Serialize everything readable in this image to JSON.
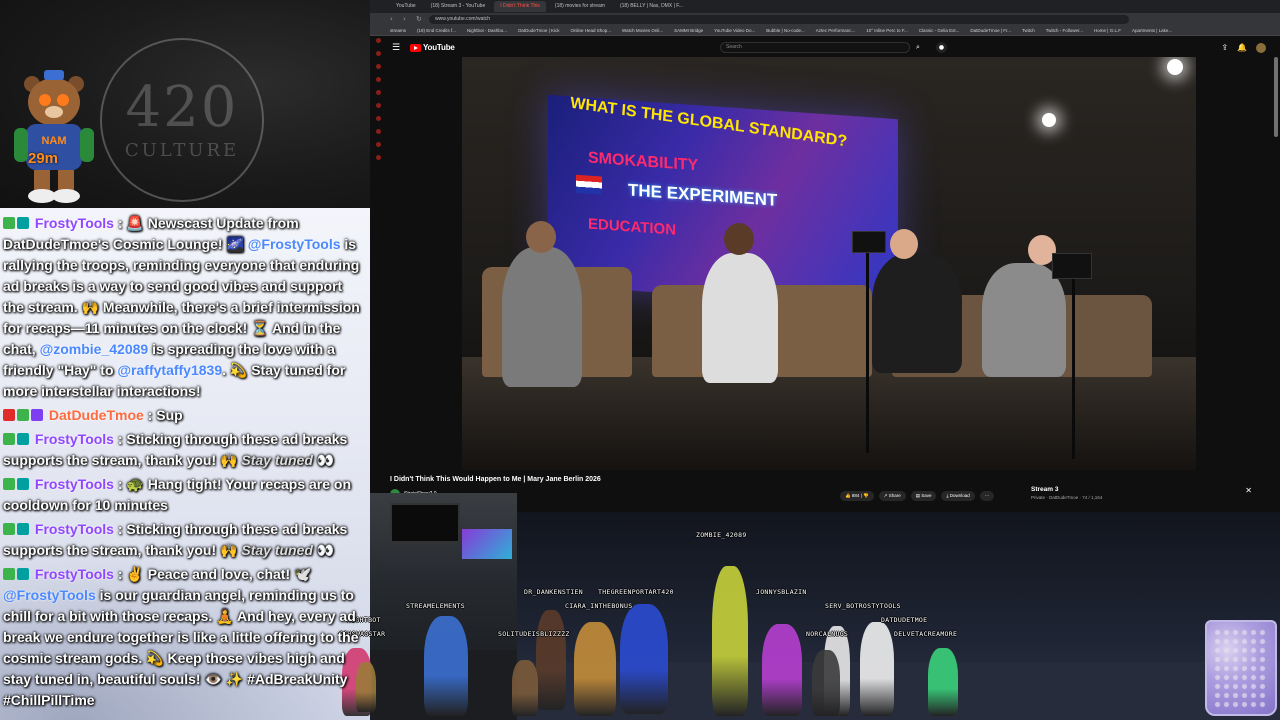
{
  "overlay": {
    "logo_number": "420",
    "logo_word": "CULTURE",
    "timer": "29m"
  },
  "chat": {
    "messages": [
      {
        "user": "FrostyTools",
        "parts": [
          " : 🚨 Newscast Update from DatDudeTmoe's Cosmic Lounge! 🌌 ",
          "@FrostyTools",
          " is rallying the troops, reminding everyone that enduring ad breaks is a way to send good vibes and support the stream. 🙌 Meanwhile, there's a brief intermission for recaps—11 minutes on the clock! ⏳ And in the chat, ",
          "@zombie_42089",
          " is spreading the love with a friendly \"Hay\" to ",
          "@raffytaffy1839",
          ". 💫 Stay tuned for more interstellar interactions!"
        ]
      },
      {
        "user": "DatDudeTmoe",
        "text": " : Sup"
      },
      {
        "user": "FrostyTools",
        "text": " : Sticking through these ad breaks supports the stream, thank you! 🙌 ",
        "tail": "Stay tuned",
        "end": " 👀"
      },
      {
        "user": "FrostyTools",
        "text": " : 🐢 Hang tight! Your recaps are on cooldown for 10 minutes"
      },
      {
        "user": "FrostyTools",
        "text": " : Sticking through these ad breaks supports the stream, thank you! 🙌 ",
        "tail": "Stay tuned",
        "end": " 👀"
      },
      {
        "user": "FrostyTools",
        "parts": [
          " : ✌️ Peace and love, chat! 🕊️ ",
          "@FrostyTools",
          " is our guardian angel, reminding us to chill for a bit with those recaps. 🧘 And hey, every ad break we endure together is like a little offering to the cosmic stream gods. 💫 Keep those vibes high and stay tuned in, beautiful souls! 👁️ ✨ #AdBreakUnity #ChillPillTime"
        ]
      }
    ]
  },
  "browser": {
    "tabs": [
      {
        "label": "YouTube",
        "active": false
      },
      {
        "label": "(18) Stream 3 - YouTube",
        "active": false
      },
      {
        "label": "I Didn't Think This",
        "active": true
      },
      {
        "label": "(18) movies for stream",
        "active": false
      },
      {
        "label": "(18) BELLY | Nas, DMX | F...",
        "active": false
      }
    ],
    "url": "www.youtube.com/watch",
    "bookmarks": [
      "streams",
      "(18) End Credits f...",
      "Nightbot - Dashbo...",
      "DatDudeTmoe | Kick",
      "Online Head Shop...",
      "Watch Movies Onli...",
      "SAMMI Bridge",
      "YouTube Video Do...",
      "Bubble | No-code...",
      "Aztec Performanc...",
      "10° Inline Perc to F...",
      "Classic - Gelia Ext...",
      "DatDudeTmoe | Fr...",
      "Twitch",
      "Twitch - Follower...",
      "Home | G.L.F",
      "Apartments | Lake..."
    ]
  },
  "youtube": {
    "logo": "YouTube",
    "search_placeholder": "Search",
    "video": {
      "slide_title": "WHAT IS THE GLOBAL STANDARD?",
      "slide_line2": "SMOKABILITY",
      "slide_line3": "THE EXPERIMENT",
      "slide_line4": "EDUCATION"
    },
    "title": "I Didn't Think This Would Happen to Me | Mary Jane Berlin 2026",
    "channel": "StrainShow2.0",
    "actions": {
      "likes": "884",
      "share": "Share",
      "save": "Save",
      "download": "Download"
    },
    "side_panel": {
      "title": "Stream 3",
      "subtitle": "Private · DatDudeTmoe · 74 / 1,164"
    }
  },
  "scene": {
    "characters": [
      {
        "name": "ZOMBIE_42089"
      },
      {
        "name": "DR_DANKENSTIEN"
      },
      {
        "name": "THEGREENPORTART420"
      },
      {
        "name": "JONNYSBLAZIN"
      },
      {
        "name": "CIARA_INTHEBONUS"
      },
      {
        "name": "STREAMELEMENTS"
      },
      {
        "name": "SERV_BOTROSTYTOOLS"
      },
      {
        "name": "DATDUDETMOE"
      },
      {
        "name": "NIGHTBOT"
      },
      {
        "name": "NORCALNUGS"
      },
      {
        "name": "DELVETACREAMORE"
      },
      {
        "name": "SOLITUDEISBLIZZZZ"
      },
      {
        "name": "GGHSWAGSTAR"
      }
    ]
  }
}
